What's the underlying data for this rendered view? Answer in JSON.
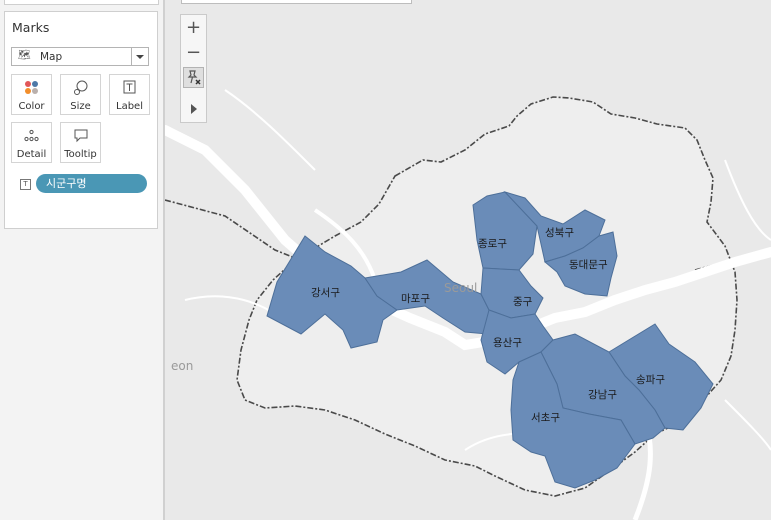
{
  "marks_card": {
    "title": "Marks",
    "mark_type": {
      "value": "Map",
      "icon": "map-icon"
    },
    "buttons": [
      {
        "label": "Color",
        "icon": "color-dots-icon"
      },
      {
        "label": "Size",
        "icon": "size-circles-icon"
      },
      {
        "label": "Label",
        "icon": "label-text-icon"
      },
      {
        "label": "Detail",
        "icon": "detail-dots-icon"
      },
      {
        "label": "Tooltip",
        "icon": "tooltip-bubble-icon"
      }
    ],
    "pill": {
      "label": "시군구명",
      "type_icon": "T",
      "color": "#4a97b5"
    }
  },
  "map": {
    "region_fill": "#6a8cb8",
    "region_stroke": "#4d6f99",
    "place_labels": [
      "Seoul",
      "eon"
    ],
    "districts": [
      {
        "name": "종로구"
      },
      {
        "name": "성북구"
      },
      {
        "name": "동대문구"
      },
      {
        "name": "강서구"
      },
      {
        "name": "마포구"
      },
      {
        "name": "중구"
      },
      {
        "name": "용산구"
      },
      {
        "name": "송파구"
      },
      {
        "name": "강남구"
      },
      {
        "name": "서초구"
      }
    ],
    "toolbar": {
      "zoom_in": "+",
      "zoom_out": "−",
      "pin_icon": "pin-map-icon",
      "expand_icon": "expand-arrow-icon"
    }
  }
}
